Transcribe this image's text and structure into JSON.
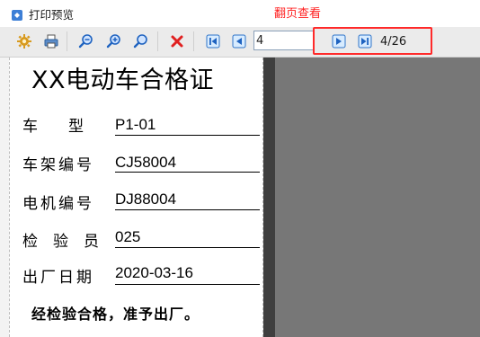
{
  "window": {
    "title": "打印预览",
    "annotation": "翻页查看"
  },
  "toolbar": {
    "buttons": [
      {
        "name": "settings",
        "icon": "gear-icon"
      },
      {
        "name": "print",
        "icon": "printer-icon"
      },
      {
        "name": "zoom-out",
        "icon": "zoom-out-icon"
      },
      {
        "name": "zoom-in",
        "icon": "zoom-in-icon"
      },
      {
        "name": "zoom-fit",
        "icon": "zoom-icon"
      },
      {
        "name": "close",
        "icon": "close-icon"
      },
      {
        "name": "first-page",
        "icon": "first-page-icon"
      },
      {
        "name": "prev-page",
        "icon": "prev-page-icon"
      },
      {
        "name": "next-page",
        "icon": "next-page-icon"
      },
      {
        "name": "last-page",
        "icon": "last-page-icon"
      }
    ],
    "page_input": "4",
    "page_count": "4/26"
  },
  "certificate": {
    "title": "XX电动车合格证",
    "fields": [
      {
        "label": "车　　型",
        "value": "P1-01"
      },
      {
        "label": "车架编号",
        "value": "CJ58004"
      },
      {
        "label": "电机编号",
        "value": "DJ88004"
      },
      {
        "label": "检　验　员",
        "value": "025"
      },
      {
        "label": "出厂日期",
        "value": "2020-03-16"
      }
    ],
    "footer": "经检验合格，准予出厂。"
  },
  "colors": {
    "annotation": "#ff2020",
    "preview_bg": "#777777",
    "nav_button": "#1f7fd1"
  }
}
